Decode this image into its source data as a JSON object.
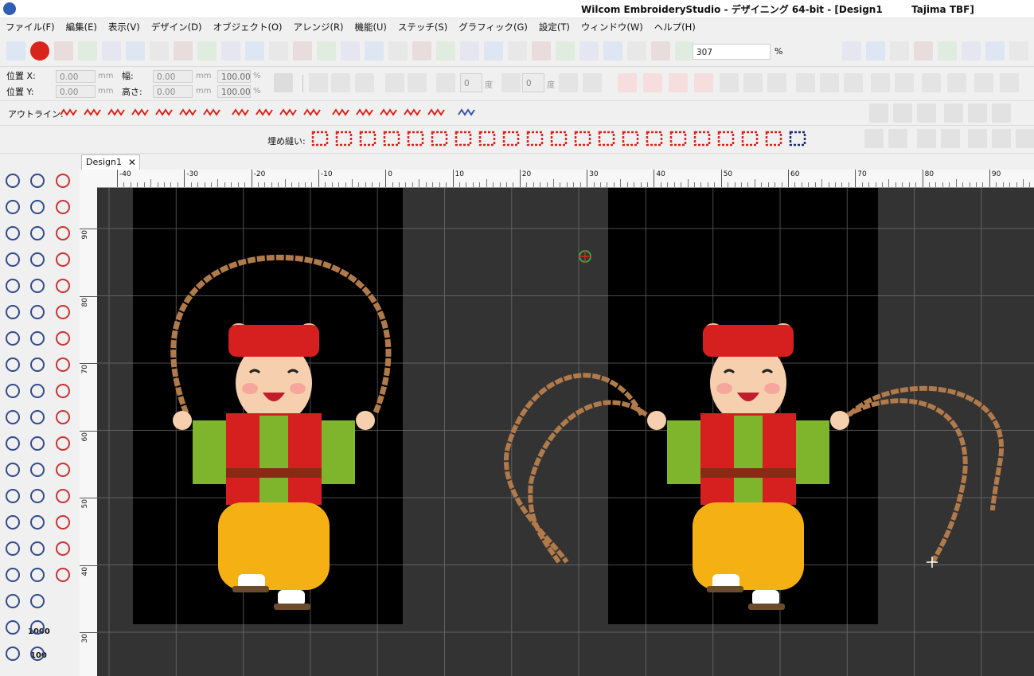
{
  "window": {
    "title": "Wilcom EmbroideryStudio - デザイニング 64-bit - [Design1",
    "machine": "Tajima TBF]"
  },
  "menu": [
    "ファイル(F)",
    "編集(E)",
    "表示(V)",
    "デザイン(D)",
    "オブジェクト(O)",
    "アレンジ(R)",
    "機能(U)",
    "ステッチ(S)",
    "グラフィック(G)",
    "設定(T)",
    "ウィンドウ(W)",
    "ヘルプ(H)"
  ],
  "toolbar": {
    "zoom_value": "307",
    "zoom_unit": "%"
  },
  "props": {
    "pos_x_label": "位置 X:",
    "pos_y_label": "位置 Y:",
    "width_label": "幅:",
    "height_label": "高さ:",
    "pos_x": "0.00",
    "pos_y": "0.00",
    "width": "0.00",
    "height": "0.00",
    "unit_mm": "mm",
    "scale_w": "100.00",
    "scale_h": "100.00",
    "unit_pct": "%",
    "angle1": "0",
    "angle2": "0",
    "deg": "度"
  },
  "outline_label": "アウトライン:",
  "fill_label": "埋め縫い:",
  "tab": {
    "label": "Design1",
    "close": "✕"
  },
  "ruler": {
    "h_ticks": [
      "-40",
      "-30",
      "-20",
      "-10",
      "0",
      "10",
      "20",
      "30",
      "40",
      "50",
      "60",
      "70",
      "80",
      "90"
    ],
    "v_ticks": [
      "90",
      "80",
      "70",
      "60",
      "50",
      "40",
      "30"
    ]
  },
  "left_tool_text": {
    "count1": "1000",
    "count2": "100"
  },
  "colors": {
    "canvas": "#333333",
    "hoop": "#000000",
    "accent_red": "#d9241b",
    "rope": "#b07a4a"
  }
}
